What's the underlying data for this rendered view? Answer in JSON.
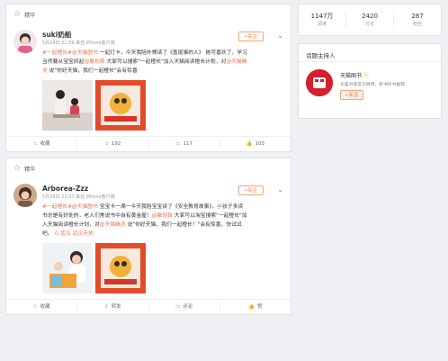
{
  "posts": [
    {
      "section_label": "精华",
      "username": "suki奶船",
      "meta": "5月28日 21:59 来自 iPhone客户端",
      "follow_label": "+关注",
      "text_parts": {
        "tag": "#一起橙长#",
        "at1": "@天猫图书",
        "p1": " 一起打卡，今天我陪外甥读了《盖尾事的人》 她可喜欢了，学习当然要从宝宝抓起",
        "at2": "@聚划算",
        "p2": " 大家可以搜索\"一起橙长\"加入天猫阅读橙长计划，对",
        "at3": "@天猫精灵",
        "p3": " 说\"你好天猫，我们一起橙长\"会有惊喜"
      },
      "actions": {
        "collect": "收藏",
        "share": "192",
        "comment": "117",
        "like": "103"
      }
    },
    {
      "section_label": "精华",
      "username": "Arborea-Zzz",
      "meta": "5月28日 21:07 来自 iPhone客户端",
      "follow_label": "+关注",
      "text_parts": {
        "tag": "#一起橙长#",
        "at1": "@天猫图书",
        "p1": " 宝宝卡一满一今天我陪宝宝读了《安全教育故事》，小孩子多读书总是有好处的，老人们常说书中自有黄金屋！",
        "at2": "@聚划算",
        "p2": " 大家可以淘宝搜索\"一起橙长\"加入天猫阅读橙长计划，对",
        "at3": "@天猫精灵",
        "p3": " 说\"你好天猫，我们一起橙长！\"会有惊喜，快试试吧。",
        "loc": "武汉 武汉天地"
      },
      "actions": {
        "collect": "收藏",
        "share": "转发",
        "comment": "评论",
        "like": "赞"
      }
    }
  ],
  "stats": [
    {
      "num": "1147万",
      "label": "阅读"
    },
    {
      "num": "2420",
      "label": "讨论"
    },
    {
      "num": "287",
      "label": "粉丝"
    }
  ],
  "host": {
    "title": "话题主持人",
    "name": "天猫图书",
    "desc": "天猫书城官方微博，新书好书推荐，",
    "follow_label": "+关注"
  }
}
